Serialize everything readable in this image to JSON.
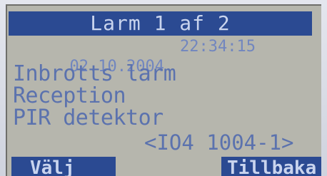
{
  "display": {
    "title": "Larm 1 af 2",
    "date": "02.10.2004",
    "time": "22:34:15",
    "alarm_type": "Inbrotts larm",
    "location": "Reception",
    "detector": "PIR detektor",
    "device_id": "<IO4 1004-1>"
  },
  "softkeys": {
    "left_label": "Välj",
    "right_label": "Tillbaka"
  },
  "colors": {
    "screen_background": "#b6b6ad",
    "highlight_bar": "#2b4a92",
    "text": "#5b72ae",
    "highlight_text": "#c9d4ee"
  }
}
